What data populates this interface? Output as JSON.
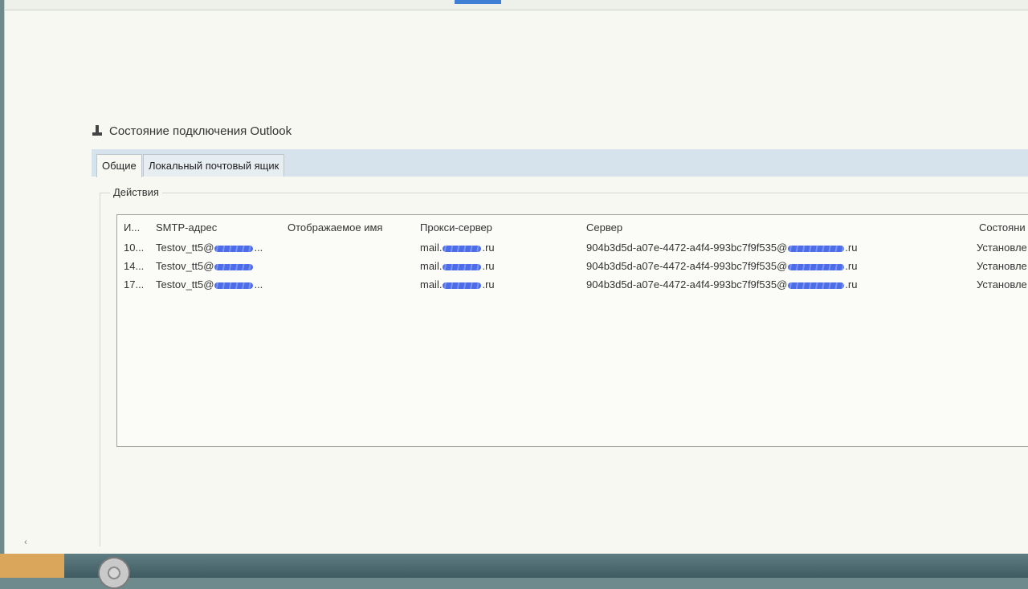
{
  "window": {
    "title": "Состояние подключения Outlook"
  },
  "tabs": [
    {
      "label": "Общие",
      "active": true
    },
    {
      "label": "Локальный почтовый ящик",
      "active": false
    }
  ],
  "group": {
    "label": "Действия"
  },
  "columns": {
    "id": "И...",
    "smtp": "SMTP-адрес",
    "display": "Отображаемое имя",
    "proxy": "Прокси-сервер",
    "server": "Сервер",
    "status": "Состояни"
  },
  "rows": [
    {
      "id": "10...",
      "smtp_prefix": "Testov_tt5@",
      "smtp_suffix": "...",
      "proxy_prefix": "mail.",
      "proxy_suffix": ".ru",
      "server_prefix": "904b3d5d-a07e-4472-a4f4-993bc7f9f535@",
      "server_suffix": ".ru",
      "status": "Установле"
    },
    {
      "id": "14...",
      "smtp_prefix": "Testov_tt5@",
      "smtp_suffix": "",
      "proxy_prefix": "mail.",
      "proxy_suffix": ".ru",
      "server_prefix": "904b3d5d-a07e-4472-a4f4-993bc7f9f535@",
      "server_suffix": ".ru",
      "status": "Установле"
    },
    {
      "id": "17...",
      "smtp_prefix": "Testov_tt5@",
      "smtp_suffix": "...",
      "proxy_prefix": "mail.",
      "proxy_suffix": ".ru",
      "server_prefix": "904b3d5d-a07e-4472-a4f4-993bc7f9f535@",
      "server_suffix": ".ru",
      "status": "Установле"
    }
  ],
  "colors": {
    "redaction": "#3a5ce6",
    "tabbar": "#d7e3ec",
    "background": "#f7f8f2"
  }
}
